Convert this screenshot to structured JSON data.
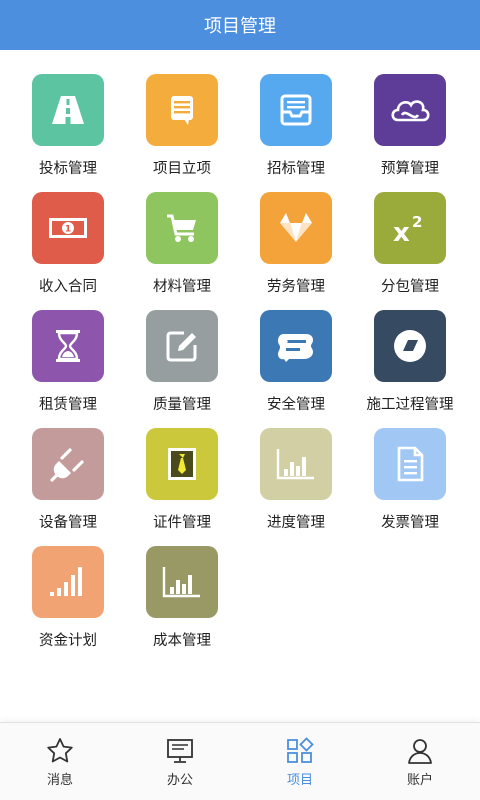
{
  "header": {
    "title": "项目管理"
  },
  "colors": {
    "header": "#4c8fde",
    "tab_active": "#4c8fde"
  },
  "modules": [
    {
      "label": "投标管理",
      "icon": "road-icon",
      "color": "#5cc4a1"
    },
    {
      "label": "项目立项",
      "icon": "message-list-icon",
      "color": "#f4ad3c"
    },
    {
      "label": "招标管理",
      "icon": "inbox-icon",
      "color": "#56a9ee"
    },
    {
      "label": "预算管理",
      "icon": "cloud-icon",
      "color": "#5e3d98"
    },
    {
      "label": "收入合同",
      "icon": "money-icon",
      "color": "#e05c4a"
    },
    {
      "label": "材料管理",
      "icon": "cart-icon",
      "color": "#8ec55e"
    },
    {
      "label": "劳务管理",
      "icon": "fox-icon",
      "color": "#f4a23a"
    },
    {
      "label": "分包管理",
      "icon": "superscript-icon",
      "color": "#9aab3b"
    },
    {
      "label": "租赁管理",
      "icon": "hourglass-icon",
      "color": "#8d55ab"
    },
    {
      "label": "质量管理",
      "icon": "edit-icon",
      "color": "#969ea0"
    },
    {
      "label": "安全管理",
      "icon": "chat-bubble-icon",
      "color": "#3c79b4"
    },
    {
      "label": "施工过程管理",
      "icon": "eraser-icon",
      "color": "#364a62"
    },
    {
      "label": "设备管理",
      "icon": "plug-icon",
      "color": "#c49b9b"
    },
    {
      "label": "证件管理",
      "icon": "id-tie-icon",
      "color": "#ccc83c"
    },
    {
      "label": "进度管理",
      "icon": "bar-chart-icon",
      "color": "#d2cfa4"
    },
    {
      "label": "发票管理",
      "icon": "document-icon",
      "color": "#a1c8f4"
    },
    {
      "label": "资金计划",
      "icon": "signal-icon",
      "color": "#f1a373"
    },
    {
      "label": "成本管理",
      "icon": "bar-chart-icon",
      "color": "#999966"
    }
  ],
  "tabs": [
    {
      "label": "消息",
      "icon": "star-icon"
    },
    {
      "label": "办公",
      "icon": "monitor-icon"
    },
    {
      "label": "项目",
      "icon": "grid-icon",
      "active": true
    },
    {
      "label": "账户",
      "icon": "user-icon"
    }
  ]
}
